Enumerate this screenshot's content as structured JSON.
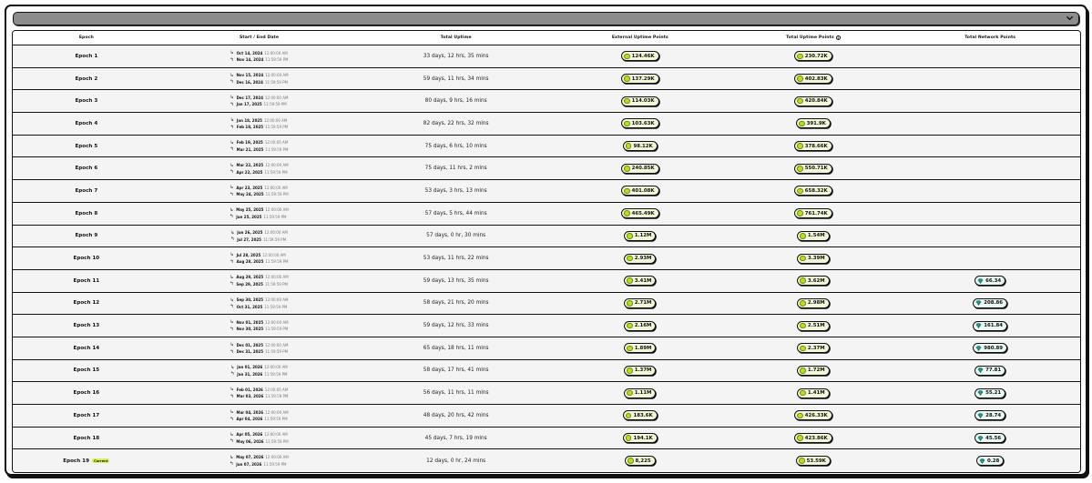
{
  "header": {
    "epoch": "Epoch",
    "dates": "Start / End Date",
    "uptime": "Total Uptime",
    "external": "External Uptime Points",
    "total_uptime_points": "Total Uptime Points",
    "network": "Total Network Points"
  },
  "icons": {
    "dropdown": "chevron-down-icon",
    "start": "start-arrow-icon",
    "end": "end-arrow-icon",
    "points": "lime-dot-icon",
    "network": "gem-icon",
    "info": "info-icon"
  },
  "colors": {
    "lime": "#b6dc26",
    "badge": "#d7ef5b",
    "gem": "#3aa39a",
    "dropdown": "#8c8c8c"
  },
  "rows": [
    {
      "epoch": "Epoch 1",
      "start_date": "Oct 14, 2024",
      "start_time": "12:00:00 AM",
      "end_date": "Nov 14, 2024",
      "end_time": "11:59:59 PM",
      "uptime": "33 days, 12 hrs, 35 mins",
      "external": "124.46K",
      "total": "230.72K",
      "network": ""
    },
    {
      "epoch": "Epoch 2",
      "start_date": "Nov 15, 2024",
      "start_time": "12:00:00 AM",
      "end_date": "Dec 16, 2024",
      "end_time": "11:59:59 PM",
      "uptime": "59 days, 11 hrs, 34 mins",
      "external": "137.29K",
      "total": "402.83K",
      "network": ""
    },
    {
      "epoch": "Epoch 3",
      "start_date": "Dec 17, 2024",
      "start_time": "12:00:00 AM",
      "end_date": "Jan 17, 2025",
      "end_time": "11:59:59 PM",
      "uptime": "80 days, 9 hrs, 16 mins",
      "external": "114.03K",
      "total": "420.84K",
      "network": ""
    },
    {
      "epoch": "Epoch 4",
      "start_date": "Jan 18, 2025",
      "start_time": "12:00:00 AM",
      "end_date": "Feb 18, 2025",
      "end_time": "11:59:59 PM",
      "uptime": "82 days, 22 hrs, 32 mins",
      "external": "103.63K",
      "total": "391.9K",
      "network": ""
    },
    {
      "epoch": "Epoch 5",
      "start_date": "Feb 19, 2025",
      "start_time": "12:00:00 AM",
      "end_date": "Mar 21, 2025",
      "end_time": "11:59:59 PM",
      "uptime": "75 days, 6 hrs, 10 mins",
      "external": "98.12K",
      "total": "378.66K",
      "network": ""
    },
    {
      "epoch": "Epoch 6",
      "start_date": "Mar 22, 2025",
      "start_time": "12:00:00 AM",
      "end_date": "Apr 22, 2025",
      "end_time": "11:59:59 PM",
      "uptime": "75 days, 11 hrs, 2 mins",
      "external": "240.85K",
      "total": "550.71K",
      "network": ""
    },
    {
      "epoch": "Epoch 7",
      "start_date": "Apr 23, 2025",
      "start_time": "12:00:00 AM",
      "end_date": "May 24, 2025",
      "end_time": "11:59:59 PM",
      "uptime": "53 days, 3 hrs, 13 mins",
      "external": "401.08K",
      "total": "658.32K",
      "network": ""
    },
    {
      "epoch": "Epoch 8",
      "start_date": "May 25, 2025",
      "start_time": "12:00:00 AM",
      "end_date": "Jun 25, 2025",
      "end_time": "11:59:59 PM",
      "uptime": "57 days, 5 hrs, 44 mins",
      "external": "465.49K",
      "total": "761.74K",
      "network": ""
    },
    {
      "epoch": "Epoch 9",
      "start_date": "Jun 26, 2025",
      "start_time": "12:00:00 AM",
      "end_date": "Jul 27, 2025",
      "end_time": "11:59:59 PM",
      "uptime": "57 days, 0 hr, 30 mins",
      "external": "1.12M",
      "total": "1.54M",
      "network": ""
    },
    {
      "epoch": "Epoch 10",
      "start_date": "Jul 28, 2025",
      "start_time": "12:00:00 AM",
      "end_date": "Aug 28, 2025",
      "end_time": "11:59:59 PM",
      "uptime": "53 days, 11 hrs, 22 mins",
      "external": "2.93M",
      "total": "3.39M",
      "network": ""
    },
    {
      "epoch": "Epoch 11",
      "start_date": "Aug 29, 2025",
      "start_time": "12:00:00 AM",
      "end_date": "Sep 29, 2025",
      "end_time": "11:59:59 PM",
      "uptime": "59 days, 13 hrs, 35 mins",
      "external": "3.41M",
      "total": "3.62M",
      "network": "66.34"
    },
    {
      "epoch": "Epoch 12",
      "start_date": "Sep 30, 2025",
      "start_time": "12:00:00 AM",
      "end_date": "Oct 31, 2025",
      "end_time": "11:59:59 PM",
      "uptime": "58 days, 21 hrs, 20 mins",
      "external": "2.71M",
      "total": "2.98M",
      "network": "208.86"
    },
    {
      "epoch": "Epoch 13",
      "start_date": "Nov 01, 2025",
      "start_time": "12:00:00 AM",
      "end_date": "Nov 30, 2025",
      "end_time": "11:59:59 PM",
      "uptime": "59 days, 12 hrs, 33 mins",
      "external": "2.16M",
      "total": "2.51M",
      "network": "161.84"
    },
    {
      "epoch": "Epoch 14",
      "start_date": "Dec 01, 2025",
      "start_time": "12:00:00 AM",
      "end_date": "Dec 31, 2025",
      "end_time": "11:59:59 PM",
      "uptime": "65 days, 18 hrs, 11 mins",
      "external": "1.89M",
      "total": "2.37M",
      "network": "980.89"
    },
    {
      "epoch": "Epoch 15",
      "start_date": "Jan 01, 2026",
      "start_time": "12:00:00 AM",
      "end_date": "Jan 31, 2026",
      "end_time": "11:59:59 PM",
      "uptime": "58 days, 17 hrs, 41 mins",
      "external": "1.37M",
      "total": "1.72M",
      "network": "77.81"
    },
    {
      "epoch": "Epoch 16",
      "start_date": "Feb 01, 2026",
      "start_time": "12:00:00 AM",
      "end_date": "Mar 03, 2026",
      "end_time": "11:59:59 PM",
      "uptime": "56 days, 11 hrs, 11 mins",
      "external": "1.11M",
      "total": "1.41M",
      "network": "55.21"
    },
    {
      "epoch": "Epoch 17",
      "start_date": "Mar 04, 2026",
      "start_time": "12:00:00 AM",
      "end_date": "Apr 04, 2026",
      "end_time": "11:59:59 PM",
      "uptime": "48 days, 20 hrs, 42 mins",
      "external": "183.6K",
      "total": "426.33K",
      "network": "28.74"
    },
    {
      "epoch": "Epoch 18",
      "start_date": "Apr 05, 2026",
      "start_time": "12:00:00 AM",
      "end_date": "May 06, 2026",
      "end_time": "11:59:59 PM",
      "uptime": "45 days, 7 hrs, 19 mins",
      "external": "194.1K",
      "total": "423.86K",
      "network": "45.56"
    },
    {
      "epoch": "Epoch 19",
      "badge": "Current",
      "start_date": "May 07, 2026",
      "start_time": "12:00:00 AM",
      "end_date": "Jun 07, 2026",
      "end_time": "11:59:59 PM",
      "uptime": "12 days, 0 hr, 24 mins",
      "external": "8,225",
      "total": "53.59K",
      "network": "0.28"
    }
  ]
}
